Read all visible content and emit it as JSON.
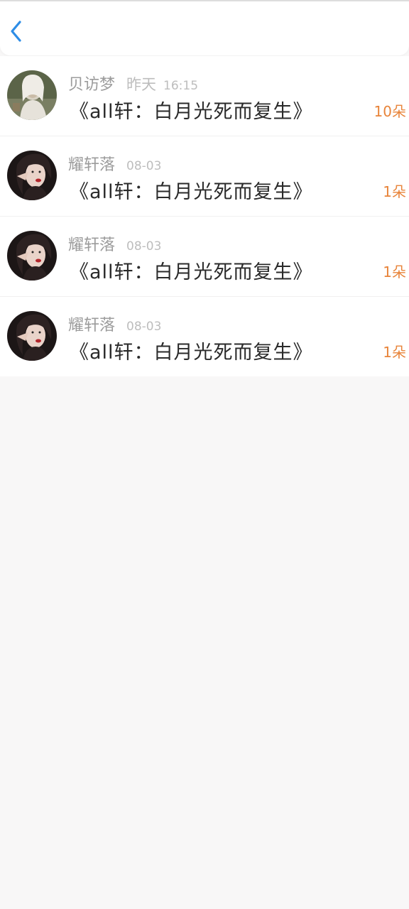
{
  "header": {
    "back_icon": "chevron-left-icon",
    "accent_color": "#2e8de6"
  },
  "items": [
    {
      "author": "贝访梦",
      "day": "昨天",
      "time": "16:15",
      "title": "《all轩：白月光死而复生》",
      "count": "10朵"
    },
    {
      "author": "耀轩落",
      "date": "08-03",
      "title": "《all轩：白月光死而复生》",
      "count": "1朵"
    },
    {
      "author": "耀轩落",
      "date": "08-03",
      "title": "《all轩：白月光死而复生》",
      "count": "1朵"
    },
    {
      "author": "耀轩落",
      "date": "08-03",
      "title": "《all轩：白月光死而复生》",
      "count": "1朵"
    }
  ],
  "colors": {
    "count": "#e8843a",
    "meta": "#9c9c9c",
    "background": "#f8f7f7"
  }
}
